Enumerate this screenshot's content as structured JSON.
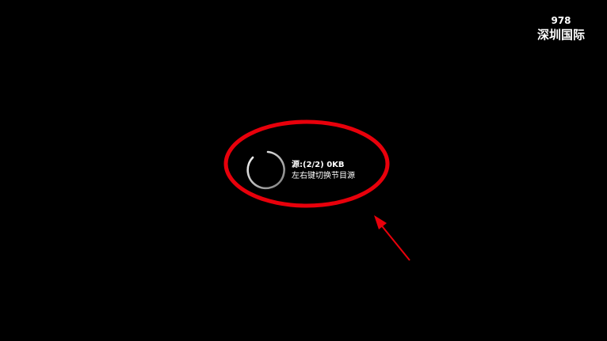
{
  "channel": {
    "number": "978",
    "name": "深圳国际"
  },
  "loading": {
    "source_label": "源:(2/2)  0KB",
    "hint": "左右键切换节目源",
    "icon": "loading-spinner-icon"
  },
  "colors": {
    "background": "#000000",
    "text": "#ffffff",
    "annotation": "#e8000b"
  }
}
